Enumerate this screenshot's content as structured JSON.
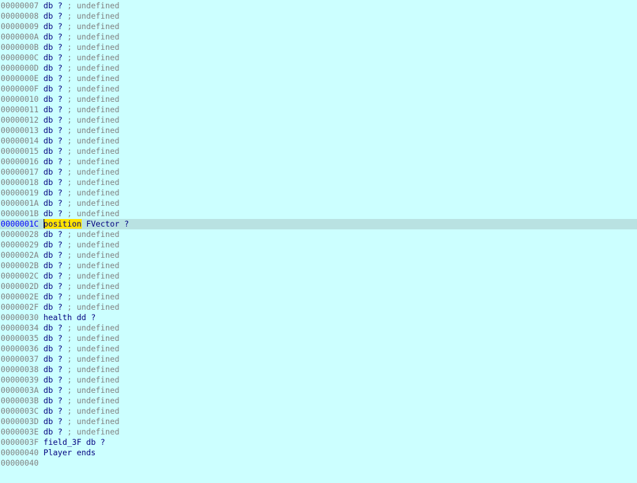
{
  "view": "structure-listing",
  "rows": [
    {
      "addr": "00000007",
      "kind": "undef",
      "op": "db",
      "val": "?",
      "comment": "undefined"
    },
    {
      "addr": "00000008",
      "kind": "undef",
      "op": "db",
      "val": "?",
      "comment": "undefined"
    },
    {
      "addr": "00000009",
      "kind": "undef",
      "op": "db",
      "val": "?",
      "comment": "undefined"
    },
    {
      "addr": "0000000A",
      "kind": "undef",
      "op": "db",
      "val": "?",
      "comment": "undefined"
    },
    {
      "addr": "0000000B",
      "kind": "undef",
      "op": "db",
      "val": "?",
      "comment": "undefined"
    },
    {
      "addr": "0000000C",
      "kind": "undef",
      "op": "db",
      "val": "?",
      "comment": "undefined"
    },
    {
      "addr": "0000000D",
      "kind": "undef",
      "op": "db",
      "val": "?",
      "comment": "undefined"
    },
    {
      "addr": "0000000E",
      "kind": "undef",
      "op": "db",
      "val": "?",
      "comment": "undefined"
    },
    {
      "addr": "0000000F",
      "kind": "undef",
      "op": "db",
      "val": "?",
      "comment": "undefined"
    },
    {
      "addr": "00000010",
      "kind": "undef",
      "op": "db",
      "val": "?",
      "comment": "undefined"
    },
    {
      "addr": "00000011",
      "kind": "undef",
      "op": "db",
      "val": "?",
      "comment": "undefined"
    },
    {
      "addr": "00000012",
      "kind": "undef",
      "op": "db",
      "val": "?",
      "comment": "undefined"
    },
    {
      "addr": "00000013",
      "kind": "undef",
      "op": "db",
      "val": "?",
      "comment": "undefined"
    },
    {
      "addr": "00000014",
      "kind": "undef",
      "op": "db",
      "val": "?",
      "comment": "undefined"
    },
    {
      "addr": "00000015",
      "kind": "undef",
      "op": "db",
      "val": "?",
      "comment": "undefined"
    },
    {
      "addr": "00000016",
      "kind": "undef",
      "op": "db",
      "val": "?",
      "comment": "undefined"
    },
    {
      "addr": "00000017",
      "kind": "undef",
      "op": "db",
      "val": "?",
      "comment": "undefined"
    },
    {
      "addr": "00000018",
      "kind": "undef",
      "op": "db",
      "val": "?",
      "comment": "undefined"
    },
    {
      "addr": "00000019",
      "kind": "undef",
      "op": "db",
      "val": "?",
      "comment": "undefined"
    },
    {
      "addr": "0000001A",
      "kind": "undef",
      "op": "db",
      "val": "?",
      "comment": "undefined"
    },
    {
      "addr": "0000001B",
      "kind": "undef",
      "op": "db",
      "val": "?",
      "comment": "undefined"
    },
    {
      "addr": "0000001C",
      "kind": "field",
      "name": "position",
      "type": "FVector",
      "val": "?",
      "selected": true,
      "highlighted_name": true
    },
    {
      "addr": "00000028",
      "kind": "undef",
      "op": "db",
      "val": "?",
      "comment": "undefined"
    },
    {
      "addr": "00000029",
      "kind": "undef",
      "op": "db",
      "val": "?",
      "comment": "undefined"
    },
    {
      "addr": "0000002A",
      "kind": "undef",
      "op": "db",
      "val": "?",
      "comment": "undefined"
    },
    {
      "addr": "0000002B",
      "kind": "undef",
      "op": "db",
      "val": "?",
      "comment": "undefined"
    },
    {
      "addr": "0000002C",
      "kind": "undef",
      "op": "db",
      "val": "?",
      "comment": "undefined"
    },
    {
      "addr": "0000002D",
      "kind": "undef",
      "op": "db",
      "val": "?",
      "comment": "undefined"
    },
    {
      "addr": "0000002E",
      "kind": "undef",
      "op": "db",
      "val": "?",
      "comment": "undefined"
    },
    {
      "addr": "0000002F",
      "kind": "undef",
      "op": "db",
      "val": "?",
      "comment": "undefined"
    },
    {
      "addr": "00000030",
      "kind": "field",
      "name": "health",
      "type": "dd",
      "val": "?"
    },
    {
      "addr": "00000034",
      "kind": "undef",
      "op": "db",
      "val": "?",
      "comment": "undefined"
    },
    {
      "addr": "00000035",
      "kind": "undef",
      "op": "db",
      "val": "?",
      "comment": "undefined"
    },
    {
      "addr": "00000036",
      "kind": "undef",
      "op": "db",
      "val": "?",
      "comment": "undefined"
    },
    {
      "addr": "00000037",
      "kind": "undef",
      "op": "db",
      "val": "?",
      "comment": "undefined"
    },
    {
      "addr": "00000038",
      "kind": "undef",
      "op": "db",
      "val": "?",
      "comment": "undefined"
    },
    {
      "addr": "00000039",
      "kind": "undef",
      "op": "db",
      "val": "?",
      "comment": "undefined"
    },
    {
      "addr": "0000003A",
      "kind": "undef",
      "op": "db",
      "val": "?",
      "comment": "undefined"
    },
    {
      "addr": "0000003B",
      "kind": "undef",
      "op": "db",
      "val": "?",
      "comment": "undefined"
    },
    {
      "addr": "0000003C",
      "kind": "undef",
      "op": "db",
      "val": "?",
      "comment": "undefined"
    },
    {
      "addr": "0000003D",
      "kind": "undef",
      "op": "db",
      "val": "?",
      "comment": "undefined"
    },
    {
      "addr": "0000003E",
      "kind": "undef",
      "op": "db",
      "val": "?",
      "comment": "undefined"
    },
    {
      "addr": "0000003F",
      "kind": "field",
      "name": "field_3F",
      "type": "db",
      "val": "?"
    },
    {
      "addr": "00000040",
      "kind": "ends",
      "text": "Player ends"
    },
    {
      "addr": "00000040",
      "kind": "empty"
    }
  ],
  "colors": {
    "background": "#ccffff",
    "selected_line": "#b9e2e2",
    "name_highlight": "#ffe400",
    "address": "#808080",
    "selected_address": "#0000ff",
    "code_text": "#00007f",
    "comment": "#808080"
  }
}
